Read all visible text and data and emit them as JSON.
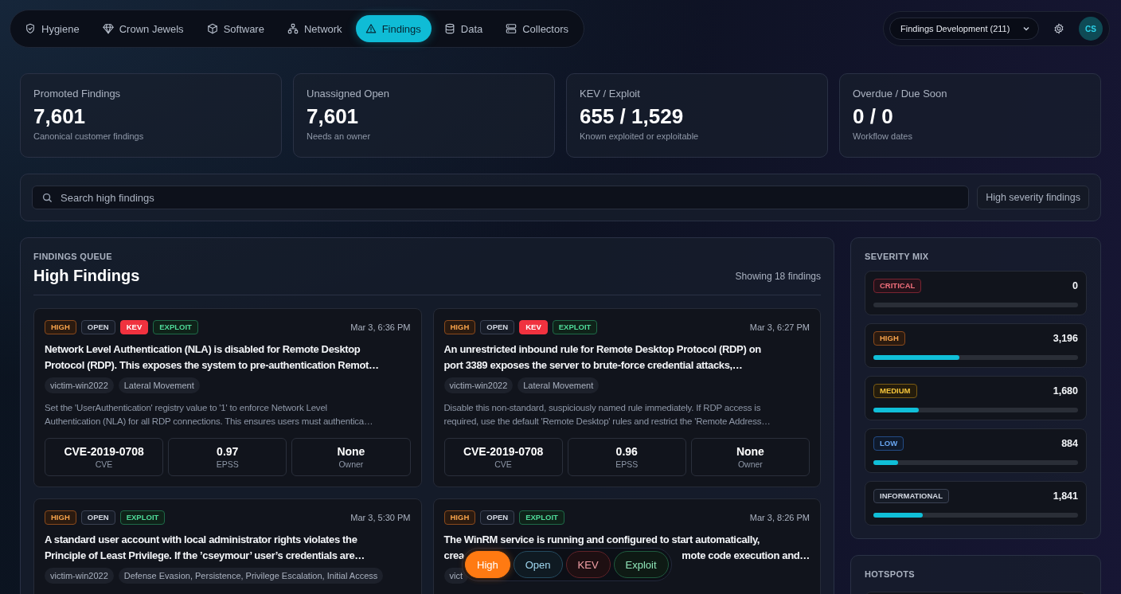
{
  "nav": {
    "tabs": [
      {
        "label": "Hygiene",
        "selected": false
      },
      {
        "label": "Crown Jewels",
        "selected": false
      },
      {
        "label": "Software",
        "selected": false
      },
      {
        "label": "Network",
        "selected": false
      },
      {
        "label": "Findings",
        "selected": true
      },
      {
        "label": "Data",
        "selected": false
      },
      {
        "label": "Collectors",
        "selected": false
      }
    ],
    "workspace": {
      "value": "Findings Development (211)"
    },
    "avatar": "CS"
  },
  "stats": [
    {
      "label": "Promoted Findings",
      "value": "7,601",
      "caption": "Canonical customer findings"
    },
    {
      "label": "Unassigned Open",
      "value": "7,601",
      "caption": "Needs an owner"
    },
    {
      "label": "KEV / Exploit",
      "value": "655 / 1,529",
      "caption": "Known exploited or exploitable"
    },
    {
      "label": "Overdue / Due Soon",
      "value": "0 / 0",
      "caption": "Workflow dates"
    }
  ],
  "search": {
    "placeholder": "Search high findings",
    "scope": "High severity findings"
  },
  "queue": {
    "eyebrow": "FINDINGS QUEUE",
    "title": "High Findings",
    "count": "Showing 18 findings",
    "cards": [
      {
        "badges": [
          {
            "kind": "high",
            "label": "HIGH"
          },
          {
            "kind": "open",
            "label": "OPEN"
          },
          {
            "kind": "kev",
            "label": "KEV"
          },
          {
            "kind": "exploit",
            "label": "EXPLOIT"
          }
        ],
        "date": "Mar 3, 6:36 PM",
        "title_lines": [
          {
            "text": "Network Level Authentication (NLA) is disabled for Remote Desktop"
          },
          {
            "text": "Protocol (RDP). This exposes the system to pre-authentication Remot…"
          }
        ],
        "tags": [
          "victim-win2022",
          "Lateral Movement"
        ],
        "description_lines": [
          "Set the 'UserAuthentication' registry value to '1' to enforce Network Level",
          "Authentication (NLA) for all RDP connections. This ensures users must authentica…"
        ],
        "metrics": [
          {
            "value": "CVE-2019-0708",
            "label": "CVE"
          },
          {
            "value": "0.97",
            "label": "EPSS"
          },
          {
            "value": "None",
            "label": "Owner"
          }
        ]
      },
      {
        "badges": [
          {
            "kind": "high",
            "label": "HIGH"
          },
          {
            "kind": "open",
            "label": "OPEN"
          },
          {
            "kind": "kev",
            "label": "KEV"
          },
          {
            "kind": "exploit",
            "label": "EXPLOIT"
          }
        ],
        "date": "Mar 3, 6:27 PM",
        "title_lines": [
          {
            "text": "An unrestricted inbound rule for Remote Desktop Protocol (RDP) on"
          },
          {
            "text": "port 3389 exposes the server to brute-force credential attacks,…"
          }
        ],
        "tags": [
          "victim-win2022",
          "Lateral Movement"
        ],
        "description_lines": [
          "Disable this non-standard, suspiciously named rule immediately. If RDP access is",
          "required, use the default 'Remote Desktop' rules and restrict the 'Remote Address…"
        ],
        "metrics": [
          {
            "value": "CVE-2019-0708",
            "label": "CVE"
          },
          {
            "value": "0.96",
            "label": "EPSS"
          },
          {
            "value": "None",
            "label": "Owner"
          }
        ]
      },
      {
        "badges": [
          {
            "kind": "high",
            "label": "HIGH"
          },
          {
            "kind": "open",
            "label": "OPEN"
          },
          {
            "kind": "exploit",
            "label": "EXPLOIT"
          }
        ],
        "date": "Mar 3, 5:30 PM",
        "title_lines": [
          {
            "text": "A standard user account with local administrator rights violates the"
          },
          {
            "text": "Principle of Least Privilege. If the ’cseymour’ user’s credentials are…"
          }
        ],
        "tags": [
          "victim-win2022",
          "Defense Evasion, Persistence, Privilege Escalation, Initial Access"
        ]
      },
      {
        "badges": [
          {
            "kind": "high",
            "label": "HIGH"
          },
          {
            "kind": "open",
            "label": "OPEN"
          },
          {
            "kind": "exploit",
            "label": "EXPLOIT"
          }
        ],
        "date": "Mar 3, 8:26 PM",
        "title_lines": [
          {
            "text": "The WinRM service is running and configured to start automatically,"
          },
          {
            "text": "crea",
            "tail": "mote code execution and…"
          }
        ],
        "tags": [
          "vict"
        ]
      }
    ]
  },
  "severity_mix": {
    "title": "SEVERITY MIX",
    "items": [
      {
        "kind": "critical",
        "label": "CRITICAL",
        "count": "0",
        "level": 0
      },
      {
        "kind": "high",
        "label": "HIGH",
        "count": "3,196",
        "level": 0.42
      },
      {
        "kind": "medium",
        "label": "MEDIUM",
        "count": "1,680",
        "level": 0.22
      },
      {
        "kind": "low",
        "label": "LOW",
        "count": "884",
        "level": 0.12
      },
      {
        "kind": "informational",
        "label": "INFORMATIONAL",
        "count": "1,841",
        "level": 0.24
      }
    ]
  },
  "hotspots": {
    "title": "HOTSPOTS"
  },
  "quick_filters": [
    {
      "kind": "high",
      "label": "High",
      "selected": true
    },
    {
      "kind": "open",
      "label": "Open",
      "selected": false
    },
    {
      "kind": "kev",
      "label": "KEV",
      "selected": false
    },
    {
      "kind": "exploit",
      "label": "Exploit",
      "selected": false
    }
  ]
}
